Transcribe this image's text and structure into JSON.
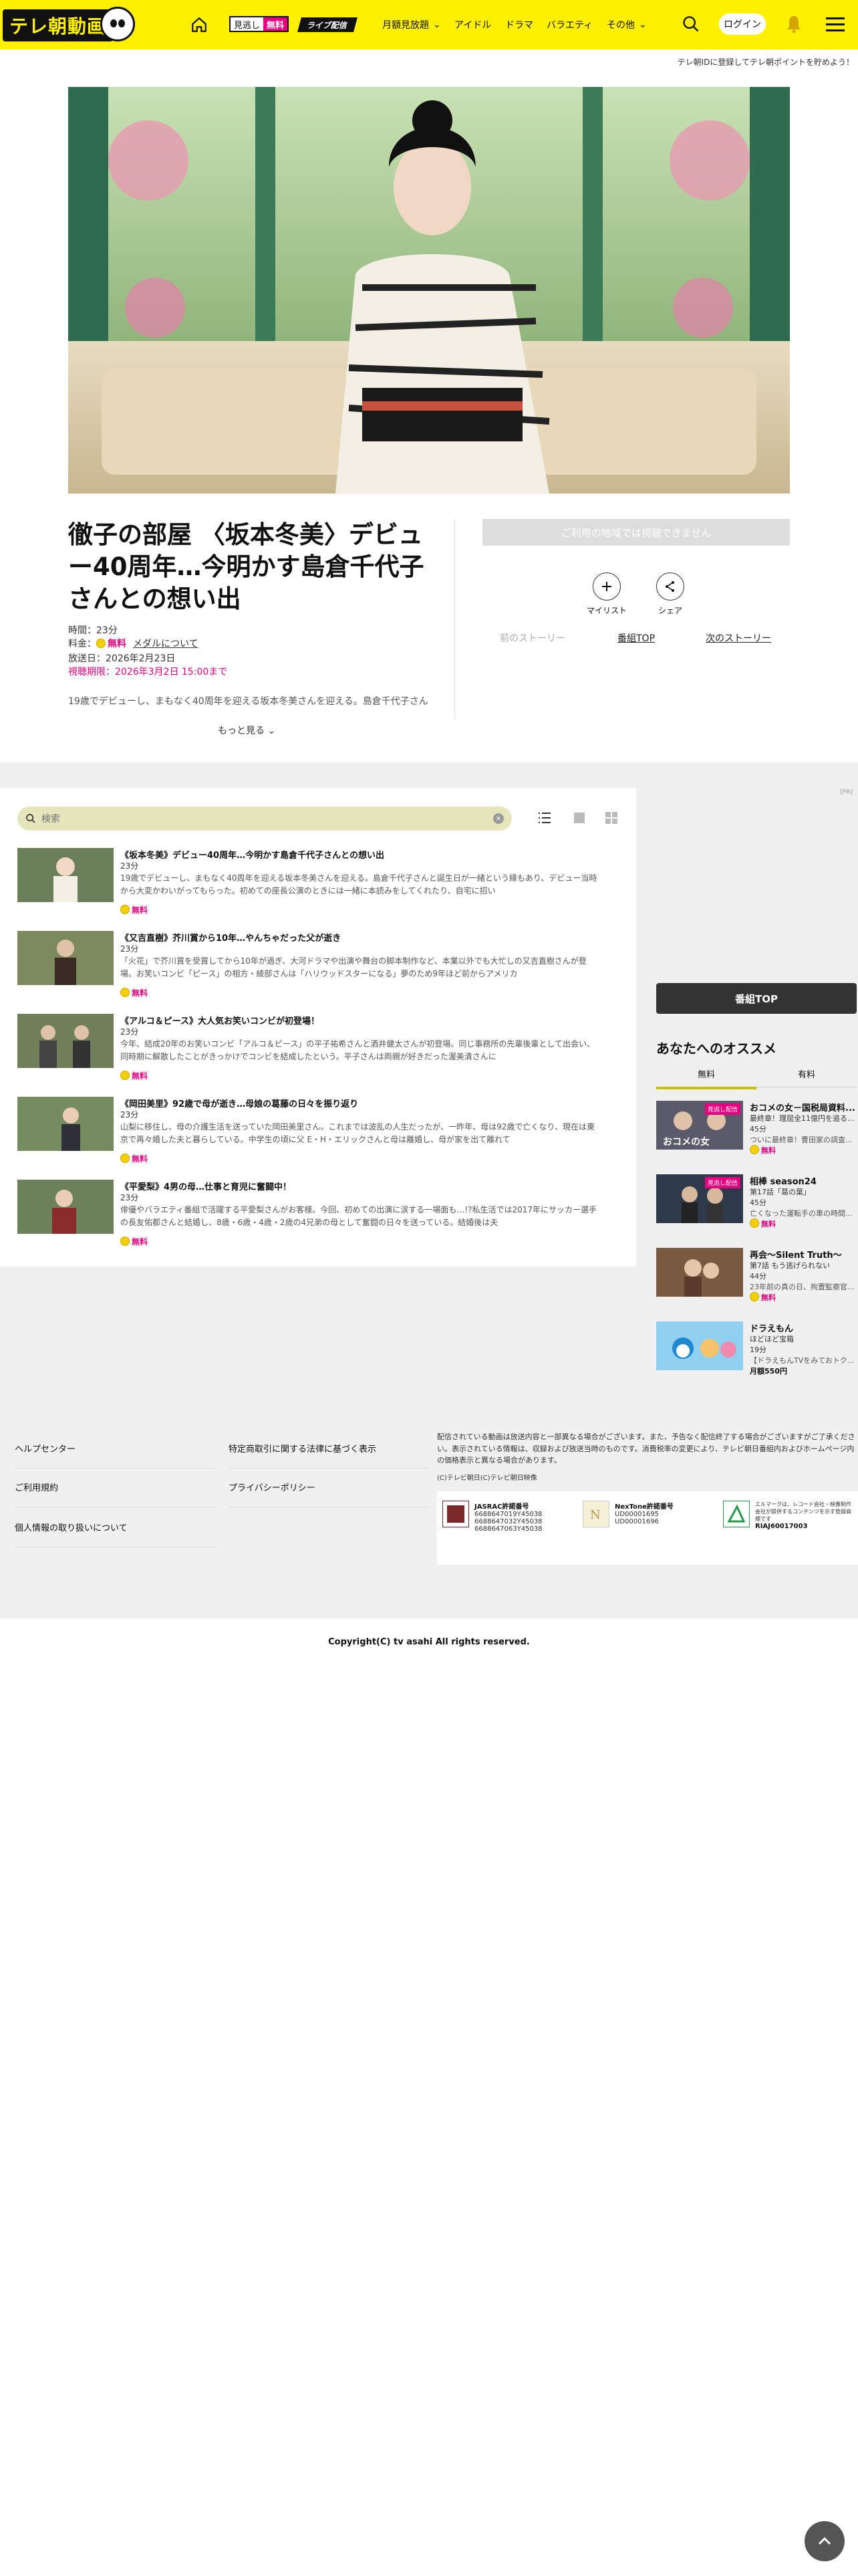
{
  "header": {
    "logo_text": "テレ朝動画",
    "badge_free_a": "見逃し",
    "badge_free_b": "無料",
    "badge_live": "ライブ配信",
    "nav": [
      "月額見放題",
      "アイドル",
      "ドラマ",
      "バラエティ",
      "その他"
    ],
    "login_label": "ログイン"
  },
  "points_note": "テレ朝IDに登録してテレ朝ポイントを貯めよう！",
  "episode": {
    "title": "徹子の部屋 〈坂本冬美〉デビュー40周年…今明かす島倉千代子さんとの想い出",
    "duration": "時間：23分",
    "price_label": "料金：",
    "price_value": "無料",
    "member_link": "メダルについて",
    "broadcast": "放送日：2026年2月23日",
    "deadline": "視聴期限：2026年3月2日 15:00まで",
    "description": "19歳でデビューし、まもなく40周年を迎える坂本冬美さんを迎える。島倉千代子さんと誕",
    "more_label": "もっと見る",
    "region_notice": "ご利用の地域では視聴できません",
    "mylist_label": "マイリスト",
    "share_label": "シェア",
    "prev_story": "前のストーリー",
    "program_top": "番組TOP",
    "next_story": "次のストーリー"
  },
  "list": {
    "search_placeholder": "検索",
    "pr_mark": "[PR]",
    "items": [
      {
        "title": "《坂本冬美》デビュー40周年…今明かす島倉千代子さんとの想い出",
        "duration": "23分",
        "summary": "19歳でデビューし、まもなく40周年を迎える坂本冬美さんを迎える。島倉千代子さんと誕生日が一緒という縁もあり、デビュー当時から大変かわいがってもらった。初めての座長公演のときには一緒に本読みをしてくれたり、自宅に招い",
        "price": "無料"
      },
      {
        "title": "《又吉直樹》芥川賞から10年…やんちゃだった父が逝き",
        "duration": "23分",
        "summary": "「火花」で芥川賞を受賞してから10年が過ぎ、大河ドラマや出演や舞台の脚本制作など、本業以外でも大忙しの又吉直樹さんが登場。お笑いコンビ「ピース」の相方・綾部さんは「ハリウッドスターになる」夢のため9年ほど前からアメリカ",
        "price": "無料"
      },
      {
        "title": "《アルコ＆ピース》大人気お笑いコンビが初登場！",
        "duration": "23分",
        "summary": "今年、結成20年のお笑いコンビ「アルコ＆ピース」の平子祐希さんと酒井健太さんが初登場。同じ事務所の先輩後輩として出会い、同時期に解散したことがきっかけでコンビを結成したという。平子さんは両親が好きだった渥美清さんに",
        "price": "無料"
      },
      {
        "title": "《岡田美里》92歳で母が逝き…母娘の葛藤の日々を振り返り",
        "duration": "23分",
        "summary": "山梨に移住し、母の介護生活を送っていた岡田美里さん。これまでは波乱の人生だったが、一昨年、母は92歳で亡くなり、現在は東京で再々婚した夫と暮らしている。中学生の頃に父 E・H・エリックさんと母は離婚し、母が家を出て離れて",
        "price": "無料"
      },
      {
        "title": "《平愛梨》4男の母…仕事と育児に奮闘中！",
        "duration": "23分",
        "summary": "俳優やバラエティ番組で活躍する平愛梨さんがお客様。今回、初めての出演に涙する一場面も…!?私生活では2017年にサッカー選手の長友佑都さんと結婚し、8歳・6歳・4歳・2歳の4兄弟の母として奮闘の日々を送っている。結婚後は夫",
        "price": "無料"
      }
    ]
  },
  "sidebar": {
    "program_top_btn": "番組TOP",
    "rec_title": "あなたへのオススメ",
    "tab_free": "無料",
    "tab_paid": "有料",
    "items": [
      {
        "title": "おコメの女－国税局資料...",
        "episode": "最終章！理屈全11億円を追る...",
        "duration": "45分",
        "summary": "ついに最終章！曹田家の調査...",
        "price": "無料",
        "badge": "見逃し配信"
      },
      {
        "title": "相棒 season24",
        "episode": "第17話「葛の葉」",
        "duration": "45分",
        "summary": "亡くなった運転手の車の時間...",
        "price": "無料",
        "badge": "見逃し配信"
      },
      {
        "title": "再会～Silent Truth～",
        "episode": "第7話 もう逃げられない",
        "duration": "44分",
        "summary": "23年前の真の日、拘置監察官...",
        "price": "無料",
        "badge": ""
      },
      {
        "title": "ドラえもん",
        "episode": "ほどほど宝箱",
        "duration": "19分",
        "summary": "【ドラえもんTVをみておトク...",
        "price": "月額550円",
        "badge": ""
      }
    ]
  },
  "footer": {
    "links_left": [
      "ヘルプセンター",
      "ご利用規約",
      "個人情報の取り扱いについて"
    ],
    "links_mid": [
      "特定商取引に関する法律に基づく表示",
      "プライバシーポリシー"
    ],
    "disclaimer": "配信されている動画は放送内容と一部異なる場合がございます。また、予告なく配信終了する場合がございますがご了承ください。表示されている情報は、収録および放送当時のものです。消費税率の変更により、テレビ朝日番組内およびホームページ内の価格表示と異なる場合があります。",
    "credit": "(C)テレビ朝日(C)テレビ朝日映像",
    "jasrac_title": "JASRAC許諾番号",
    "jasrac_nums": [
      "6688647019Y45038",
      "6688647032Y45038",
      "6688647063Y45038"
    ],
    "nextone_title": "NexTone許諾番号",
    "nextone_nums": [
      "UD00001695",
      "UD00001696"
    ],
    "riaj_text": "エルマークは、レコード会社・映像制作会社が提供するコンテンツを示す登録商標です",
    "riaj_num": "RIAJ60017003",
    "copyright": "Copyright(C) tv asahi All rights reserved."
  },
  "colors": {
    "brand_yellow": "#fff000",
    "accent_pink": "#e4007f"
  }
}
